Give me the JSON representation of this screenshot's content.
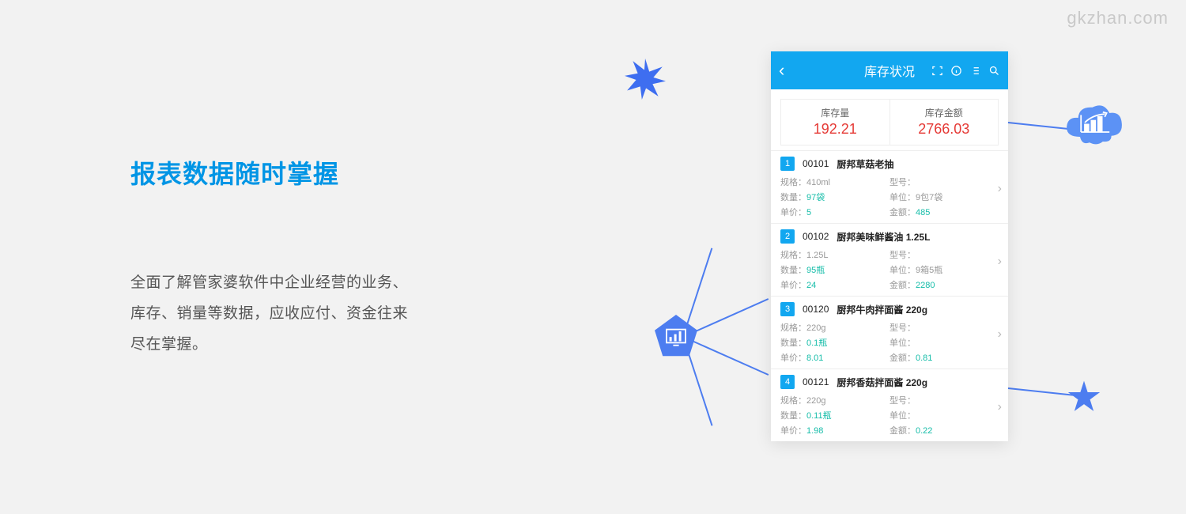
{
  "watermark": "gkzhan.com",
  "marketing": {
    "headline": "报表数据随时掌握",
    "body_l1": "全面了解管家婆软件中企业经营的业务、",
    "body_l2": "库存、销量等数据，应收应付、资金往来",
    "body_l3": "尽在掌握。"
  },
  "phone": {
    "title": "库存状况",
    "summary": {
      "qty_label": "库存量",
      "qty_value": "192.21",
      "amount_label": "库存金额",
      "amount_value": "2766.03"
    },
    "labels": {
      "spec": "规格：",
      "model": "型号：",
      "qty": "数量：",
      "unit": "单位：",
      "price": "单价：",
      "amount": "金额："
    },
    "items": [
      {
        "idx": "1",
        "code": "00101",
        "name": "厨邦草菇老抽",
        "spec": "410ml",
        "model": "",
        "qty": "97袋",
        "unit": "9包7袋",
        "price": "5",
        "amount": "485"
      },
      {
        "idx": "2",
        "code": "00102",
        "name": "厨邦美味鲜酱油 1.25L",
        "spec": "1.25L",
        "model": "",
        "qty": "95瓶",
        "unit": "9箱5瓶",
        "price": "24",
        "amount": "2280"
      },
      {
        "idx": "3",
        "code": "00120",
        "name": "厨邦牛肉拌面酱 220g",
        "spec": "220g",
        "model": "",
        "qty": "0.1瓶",
        "unit": "",
        "price": "8.01",
        "amount": "0.81"
      },
      {
        "idx": "4",
        "code": "00121",
        "name": "厨邦香菇拌面酱 220g",
        "spec": "220g",
        "model": "",
        "qty": "0.11瓶",
        "unit": "",
        "price": "1.98",
        "amount": "0.22"
      }
    ]
  }
}
